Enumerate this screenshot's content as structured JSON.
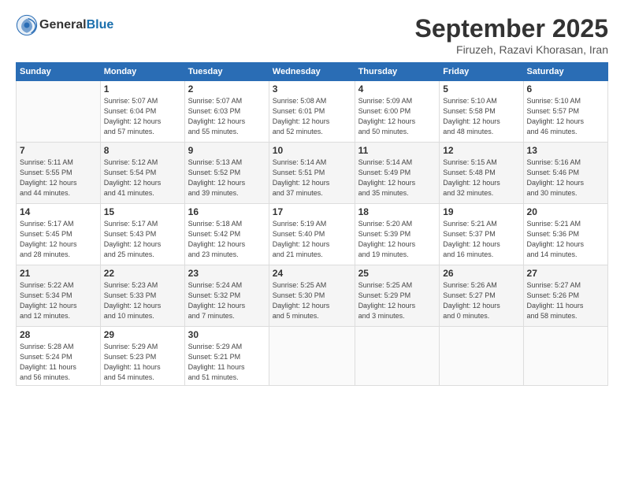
{
  "header": {
    "logo_general": "General",
    "logo_blue": "Blue",
    "month": "September 2025",
    "location": "Firuzeh, Razavi Khorasan, Iran"
  },
  "weekdays": [
    "Sunday",
    "Monday",
    "Tuesday",
    "Wednesday",
    "Thursday",
    "Friday",
    "Saturday"
  ],
  "weeks": [
    [
      {
        "day": "",
        "detail": ""
      },
      {
        "day": "1",
        "detail": "Sunrise: 5:07 AM\nSunset: 6:04 PM\nDaylight: 12 hours\nand 57 minutes."
      },
      {
        "day": "2",
        "detail": "Sunrise: 5:07 AM\nSunset: 6:03 PM\nDaylight: 12 hours\nand 55 minutes."
      },
      {
        "day": "3",
        "detail": "Sunrise: 5:08 AM\nSunset: 6:01 PM\nDaylight: 12 hours\nand 52 minutes."
      },
      {
        "day": "4",
        "detail": "Sunrise: 5:09 AM\nSunset: 6:00 PM\nDaylight: 12 hours\nand 50 minutes."
      },
      {
        "day": "5",
        "detail": "Sunrise: 5:10 AM\nSunset: 5:58 PM\nDaylight: 12 hours\nand 48 minutes."
      },
      {
        "day": "6",
        "detail": "Sunrise: 5:10 AM\nSunset: 5:57 PM\nDaylight: 12 hours\nand 46 minutes."
      }
    ],
    [
      {
        "day": "7",
        "detail": "Sunrise: 5:11 AM\nSunset: 5:55 PM\nDaylight: 12 hours\nand 44 minutes."
      },
      {
        "day": "8",
        "detail": "Sunrise: 5:12 AM\nSunset: 5:54 PM\nDaylight: 12 hours\nand 41 minutes."
      },
      {
        "day": "9",
        "detail": "Sunrise: 5:13 AM\nSunset: 5:52 PM\nDaylight: 12 hours\nand 39 minutes."
      },
      {
        "day": "10",
        "detail": "Sunrise: 5:14 AM\nSunset: 5:51 PM\nDaylight: 12 hours\nand 37 minutes."
      },
      {
        "day": "11",
        "detail": "Sunrise: 5:14 AM\nSunset: 5:49 PM\nDaylight: 12 hours\nand 35 minutes."
      },
      {
        "day": "12",
        "detail": "Sunrise: 5:15 AM\nSunset: 5:48 PM\nDaylight: 12 hours\nand 32 minutes."
      },
      {
        "day": "13",
        "detail": "Sunrise: 5:16 AM\nSunset: 5:46 PM\nDaylight: 12 hours\nand 30 minutes."
      }
    ],
    [
      {
        "day": "14",
        "detail": "Sunrise: 5:17 AM\nSunset: 5:45 PM\nDaylight: 12 hours\nand 28 minutes."
      },
      {
        "day": "15",
        "detail": "Sunrise: 5:17 AM\nSunset: 5:43 PM\nDaylight: 12 hours\nand 25 minutes."
      },
      {
        "day": "16",
        "detail": "Sunrise: 5:18 AM\nSunset: 5:42 PM\nDaylight: 12 hours\nand 23 minutes."
      },
      {
        "day": "17",
        "detail": "Sunrise: 5:19 AM\nSunset: 5:40 PM\nDaylight: 12 hours\nand 21 minutes."
      },
      {
        "day": "18",
        "detail": "Sunrise: 5:20 AM\nSunset: 5:39 PM\nDaylight: 12 hours\nand 19 minutes."
      },
      {
        "day": "19",
        "detail": "Sunrise: 5:21 AM\nSunset: 5:37 PM\nDaylight: 12 hours\nand 16 minutes."
      },
      {
        "day": "20",
        "detail": "Sunrise: 5:21 AM\nSunset: 5:36 PM\nDaylight: 12 hours\nand 14 minutes."
      }
    ],
    [
      {
        "day": "21",
        "detail": "Sunrise: 5:22 AM\nSunset: 5:34 PM\nDaylight: 12 hours\nand 12 minutes."
      },
      {
        "day": "22",
        "detail": "Sunrise: 5:23 AM\nSunset: 5:33 PM\nDaylight: 12 hours\nand 10 minutes."
      },
      {
        "day": "23",
        "detail": "Sunrise: 5:24 AM\nSunset: 5:32 PM\nDaylight: 12 hours\nand 7 minutes."
      },
      {
        "day": "24",
        "detail": "Sunrise: 5:25 AM\nSunset: 5:30 PM\nDaylight: 12 hours\nand 5 minutes."
      },
      {
        "day": "25",
        "detail": "Sunrise: 5:25 AM\nSunset: 5:29 PM\nDaylight: 12 hours\nand 3 minutes."
      },
      {
        "day": "26",
        "detail": "Sunrise: 5:26 AM\nSunset: 5:27 PM\nDaylight: 12 hours\nand 0 minutes."
      },
      {
        "day": "27",
        "detail": "Sunrise: 5:27 AM\nSunset: 5:26 PM\nDaylight: 11 hours\nand 58 minutes."
      }
    ],
    [
      {
        "day": "28",
        "detail": "Sunrise: 5:28 AM\nSunset: 5:24 PM\nDaylight: 11 hours\nand 56 minutes."
      },
      {
        "day": "29",
        "detail": "Sunrise: 5:29 AM\nSunset: 5:23 PM\nDaylight: 11 hours\nand 54 minutes."
      },
      {
        "day": "30",
        "detail": "Sunrise: 5:29 AM\nSunset: 5:21 PM\nDaylight: 11 hours\nand 51 minutes."
      },
      {
        "day": "",
        "detail": ""
      },
      {
        "day": "",
        "detail": ""
      },
      {
        "day": "",
        "detail": ""
      },
      {
        "day": "",
        "detail": ""
      }
    ]
  ]
}
